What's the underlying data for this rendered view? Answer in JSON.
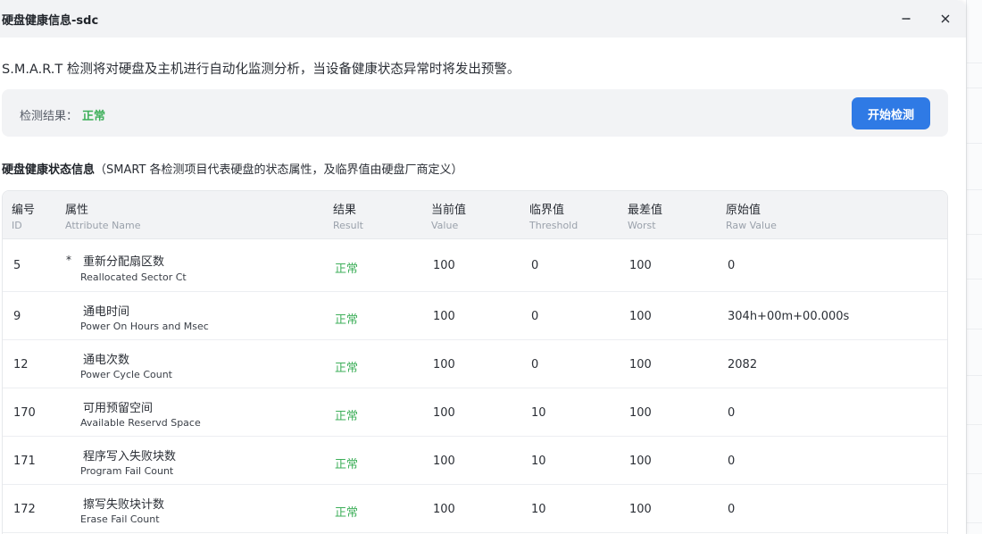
{
  "window": {
    "title": "硬盘健康信息-sdc",
    "minimize_icon": "minimize-icon",
    "close_icon": "close-icon"
  },
  "description": "S.M.A.R.T 检测将对硬盘及主机进行自动化监测分析，当设备健康状态异常时将发出预警。",
  "result": {
    "label": "检测结果：",
    "value": "正常",
    "value_color": "#3eaf5a",
    "button_label": "开始检测",
    "button_color": "#2f7ae5"
  },
  "section": {
    "title": "硬盘健康状态信息",
    "subtitle": "（SMART 各检测项目代表硬盘的状态属性，及临界值由硬盘厂商定义）"
  },
  "table": {
    "columns": [
      {
        "cn": "编号",
        "en": "ID"
      },
      {
        "cn": "属性",
        "en": "Attribute Name"
      },
      {
        "cn": "结果",
        "en": "Result"
      },
      {
        "cn": "当前值",
        "en": "Value"
      },
      {
        "cn": "临界值",
        "en": "Threshold"
      },
      {
        "cn": "最差值",
        "en": "Worst"
      },
      {
        "cn": "原始值",
        "en": "Raw Value"
      }
    ],
    "rows": [
      {
        "id": "5",
        "marker": "*",
        "name_cn": "重新分配扇区数",
        "name_en": "Reallocated Sector Ct",
        "result": "正常",
        "value": "100",
        "threshold": "0",
        "worst": "100",
        "raw": "0"
      },
      {
        "id": "9",
        "marker": "",
        "name_cn": "通电时间",
        "name_en": "Power On Hours and Msec",
        "result": "正常",
        "value": "100",
        "threshold": "0",
        "worst": "100",
        "raw": "304h+00m+00.000s"
      },
      {
        "id": "12",
        "marker": "",
        "name_cn": "通电次数",
        "name_en": "Power Cycle Count",
        "result": "正常",
        "value": "100",
        "threshold": "0",
        "worst": "100",
        "raw": "2082"
      },
      {
        "id": "170",
        "marker": "",
        "name_cn": "可用预留空间",
        "name_en": "Available Reservd Space",
        "result": "正常",
        "value": "100",
        "threshold": "10",
        "worst": "100",
        "raw": "0"
      },
      {
        "id": "171",
        "marker": "",
        "name_cn": "程序写入失败块数",
        "name_en": "Program Fail Count",
        "result": "正常",
        "value": "100",
        "threshold": "10",
        "worst": "100",
        "raw": "0"
      },
      {
        "id": "172",
        "marker": "",
        "name_cn": "擦写失败块计数",
        "name_en": "Erase Fail Count",
        "result": "正常",
        "value": "100",
        "threshold": "10",
        "worst": "100",
        "raw": "0"
      }
    ]
  }
}
